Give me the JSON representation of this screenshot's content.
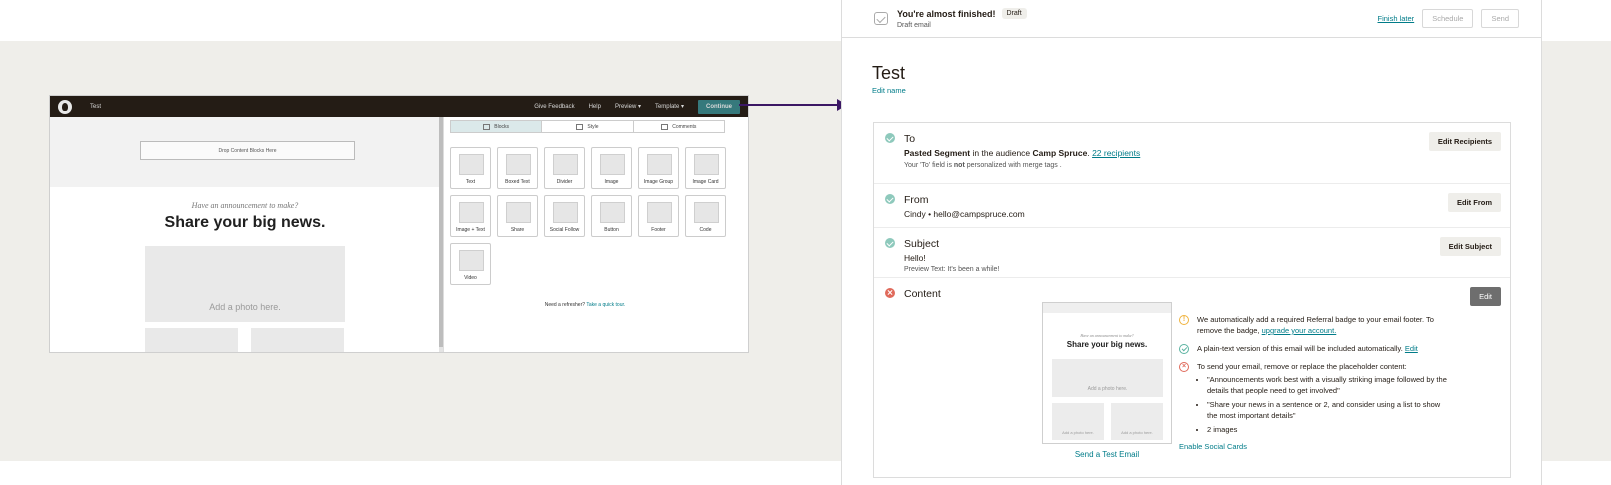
{
  "editor": {
    "title": "Test",
    "nav": {
      "feedback": "Give Feedback",
      "help": "Help",
      "preview": "Preview ▾",
      "template": "Template ▾",
      "continue": "Continue"
    },
    "drop_label": "Drop Content Blocks Here",
    "announce": "Have an announcement to make?",
    "headline": "Share your big news.",
    "photo_label": "Add a photo here.",
    "tabs": [
      "Blocks",
      "Style",
      "Comments"
    ],
    "blocks": [
      "Text",
      "Boxed Text",
      "Divider",
      "Image",
      "Image Group",
      "Image Card",
      "Image + Text",
      "Share",
      "Social Follow",
      "Button",
      "Footer",
      "Code",
      "Video"
    ],
    "refresh_text": "Need a refresher?",
    "refresh_link": "Take a quick tour."
  },
  "topbar": {
    "headline": "You're almost finished!",
    "badge": "Draft",
    "sub": "Draft email",
    "finish_later": "Finish later",
    "schedule": "Schedule",
    "send": "Send"
  },
  "campaign": {
    "title": "Test",
    "edit_name": "Edit name"
  },
  "to": {
    "title": "To",
    "segment": "Pasted Segment",
    "mid": " in the audience ",
    "audience": "Camp Spruce",
    "sep": ". ",
    "recipients": "22 recipients",
    "note_pre": "Your 'To' field is ",
    "note_bold": "not",
    "note_post": " personalized with merge tags .",
    "button": "Edit Recipients"
  },
  "from": {
    "title": "From",
    "value": "Cindy • hello@campspruce.com",
    "button": "Edit From"
  },
  "subject": {
    "title": "Subject",
    "value": "Hello!",
    "preview": "Preview Text: It's been a while!",
    "button": "Edit Subject"
  },
  "content": {
    "title": "Content",
    "button": "Edit",
    "preview_announce": "Have an announcement to make?",
    "preview_headline": "Share your big news.",
    "preview_photo": "Add a photo here.",
    "send_test": "Send a Test Email",
    "note1_pre": "We automatically add a required Referral badge to your email footer. To remove the badge, ",
    "note1_link": "upgrade your account.",
    "note2_pre": "A plain-text version of this email will be included automatically. ",
    "note2_link": "Edit",
    "note3": "To send your email, remove or replace the placeholder content:",
    "bullets": [
      "\"Announcements work best with a visually striking image followed by the details that people need to get involved\"",
      "\"Share your news in a sentence or 2, and consider using a list to show the most important details\"",
      "2 images"
    ],
    "social": "Enable Social Cards"
  },
  "colors": {
    "accent": "#007c89",
    "continue": "#36797c",
    "arrow": "#3b1764",
    "success": "#8ec9bc",
    "error": "#e06a5b"
  }
}
